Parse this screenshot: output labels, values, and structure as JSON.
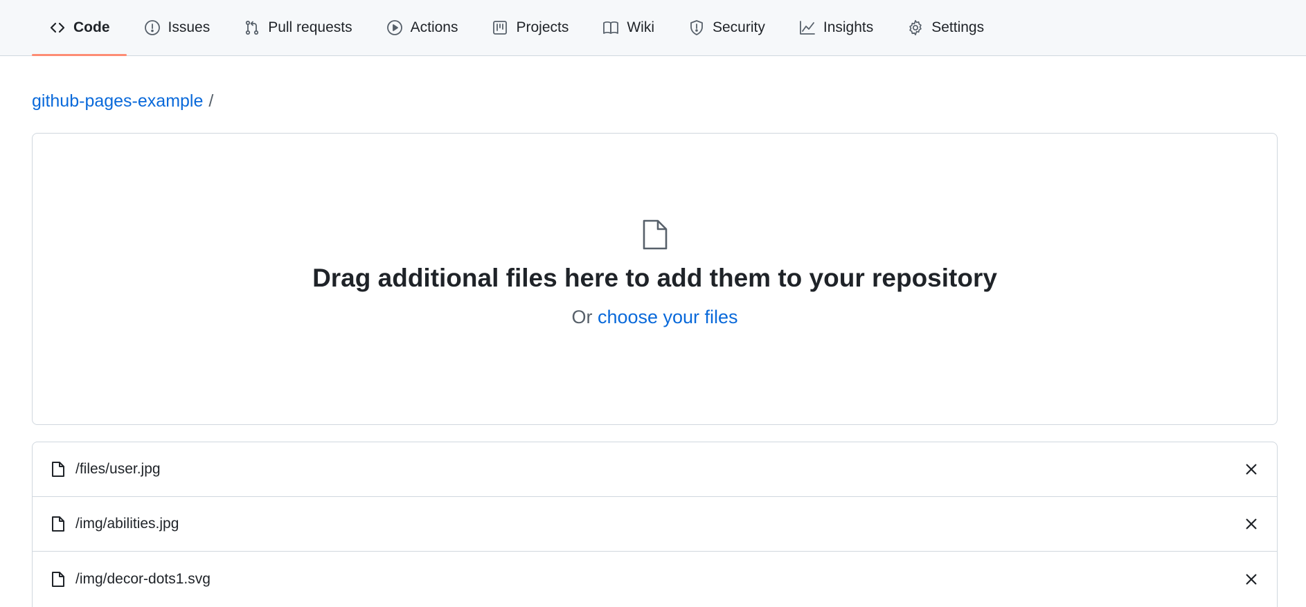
{
  "nav": {
    "tabs": [
      {
        "label": "Code",
        "icon": "code-icon",
        "selected": true
      },
      {
        "label": "Issues",
        "icon": "issue-icon"
      },
      {
        "label": "Pull requests",
        "icon": "pull-request-icon"
      },
      {
        "label": "Actions",
        "icon": "play-icon"
      },
      {
        "label": "Projects",
        "icon": "project-icon"
      },
      {
        "label": "Wiki",
        "icon": "book-icon"
      },
      {
        "label": "Security",
        "icon": "shield-icon"
      },
      {
        "label": "Insights",
        "icon": "graph-icon"
      },
      {
        "label": "Settings",
        "icon": "gear-icon"
      }
    ],
    "accent_color": "#fd8c73"
  },
  "breadcrumb": {
    "repo": "github-pages-example",
    "separator": "/"
  },
  "dropzone": {
    "icon": "file-icon",
    "title": "Drag additional files here to add them to your repository",
    "prefix": "Or",
    "link": "choose your files"
  },
  "files": [
    {
      "name": "/files/user.jpg",
      "icon": "file-icon",
      "action_icon": "close-icon"
    },
    {
      "name": "/img/abilities.jpg",
      "icon": "file-icon",
      "action_icon": "close-icon"
    },
    {
      "name": "/img/decor-dots1.svg",
      "icon": "file-icon",
      "action_icon": "close-icon"
    }
  ],
  "colors": {
    "link": "#0969da",
    "border": "#d0d7de",
    "nav_bg": "#f6f8fa"
  }
}
